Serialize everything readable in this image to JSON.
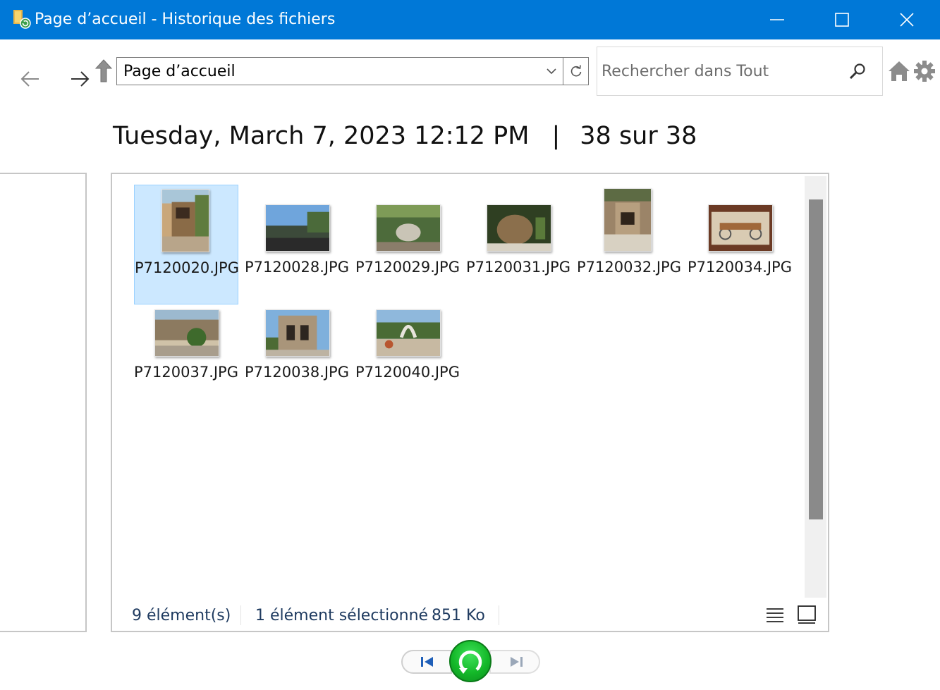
{
  "window": {
    "title": "Page d’accueil - Historique des fichiers",
    "controls": [
      "minimize",
      "maximize",
      "close"
    ]
  },
  "navigation": {
    "address": "Page d’accueil",
    "search_placeholder": "Rechercher dans Tout"
  },
  "header": {
    "date": "Tuesday, March 7, 2023 12:12 PM",
    "separator": "|",
    "position": "38 sur 38"
  },
  "files": [
    {
      "name": "P7120020.JPG",
      "selected": true
    },
    {
      "name": "P7120028.JPG",
      "selected": false
    },
    {
      "name": "P7120029.JPG",
      "selected": false
    },
    {
      "name": "P7120031.JPG",
      "selected": false
    },
    {
      "name": "P7120032.JPG",
      "selected": false
    },
    {
      "name": "P7120034.JPG",
      "selected": false
    },
    {
      "name": "P7120037.JPG",
      "selected": false
    },
    {
      "name": "P7120038.JPG",
      "selected": false
    },
    {
      "name": "P7120040.JPG",
      "selected": false
    }
  ],
  "status": {
    "item_count": "9 élément(s)",
    "selection": "1 élément sélectionné",
    "size": "851 Ko"
  },
  "colors": {
    "titlebar": "#0078d7",
    "selection_bg": "#cce8ff",
    "restore_green": "#14b829"
  },
  "icons": [
    "app-icon",
    "back-arrow-icon",
    "forward-arrow-icon",
    "up-arrow-icon",
    "chevron-down-icon",
    "refresh-icon",
    "search-icon",
    "home-icon",
    "gear-icon",
    "details-view-icon",
    "large-icons-view-icon",
    "previous-version-icon",
    "restore-icon",
    "next-version-icon"
  ]
}
